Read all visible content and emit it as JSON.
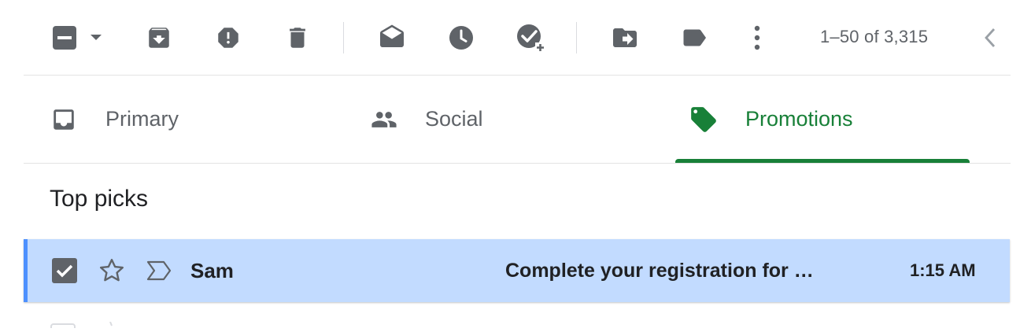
{
  "colors": {
    "icon_gray": "#5f6368",
    "accent_green": "#188038",
    "selected_row_bg": "#c2dbff",
    "selected_row_border": "#4d90fe"
  },
  "toolbar": {
    "icons": [
      "select-checkbox-indeterminate-icon",
      "chevron-down-icon",
      "archive-icon",
      "report-spam-icon",
      "delete-icon",
      "mark-as-read-icon",
      "snooze-icon",
      "add-to-tasks-icon",
      "move-to-icon",
      "label-icon",
      "more-vert-icon",
      "chevron-left-icon"
    ],
    "pagination": "1–50 of 3,315"
  },
  "tabs": [
    {
      "label": "Primary",
      "icon": "inbox-icon",
      "active": false
    },
    {
      "label": "Social",
      "icon": "people-icon",
      "active": false
    },
    {
      "label": "Promotions",
      "icon": "tag-icon",
      "active": true
    }
  ],
  "section": {
    "title": "Top picks"
  },
  "email": {
    "selected": true,
    "starred": false,
    "sender": "Sam",
    "subject": "Complete your registration for …",
    "time": "1:15 AM"
  }
}
